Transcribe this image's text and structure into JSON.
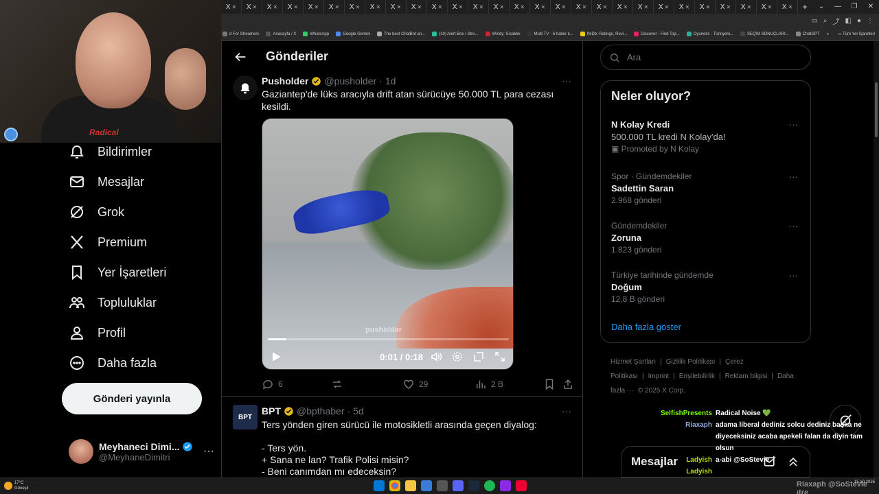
{
  "browser": {
    "tab_label": "X",
    "tab_count": 28,
    "bookmarks": [
      {
        "label": "d For Streamers",
        "color": "#777"
      },
      {
        "label": "Anasayfa / X",
        "color": "#555"
      },
      {
        "label": "WhatsApp",
        "color": "#25d366"
      },
      {
        "label": "Google Gemini",
        "color": "#4a8af4"
      },
      {
        "label": "The best ChatBot an...",
        "color": "#aaa"
      },
      {
        "label": "(19) Alert Box / Stre...",
        "color": "#2fbf9b"
      },
      {
        "label": "Windy: Sıcaklık",
        "color": "#c23"
      },
      {
        "label": "Multi TV - 6 haber k...",
        "color": "#333"
      },
      {
        "label": "IMDb: Ratings, Revi...",
        "color": "#f5c518"
      },
      {
        "label": "Discover - Find Top...",
        "color": "#e0245e"
      },
      {
        "label": "Oyuneks - Türkiyeni...",
        "color": "#3a9"
      },
      {
        "label": "SEÇİM SONUÇLARI...",
        "color": "#444"
      },
      {
        "label": "ChatGPT",
        "color": "#888"
      }
    ],
    "bookmarks_more": "»",
    "all_bookmarks": "Tüm Yer İşaretleri"
  },
  "webcam": {
    "shirt_text": "Radical"
  },
  "nav": {
    "items": [
      {
        "label": "Bildirimler",
        "icon": "bell-icon"
      },
      {
        "label": "Mesajlar",
        "icon": "mail-icon"
      },
      {
        "label": "Grok",
        "icon": "grok-icon"
      },
      {
        "label": "Premium",
        "icon": "x-logo-icon"
      },
      {
        "label": "Yer İşaretleri",
        "icon": "bookmark-icon"
      },
      {
        "label": "Topluluklar",
        "icon": "communities-icon"
      },
      {
        "label": "Profil",
        "icon": "profile-icon"
      },
      {
        "label": "Daha fazla",
        "icon": "more-circle-icon"
      }
    ],
    "post_button": "Gönderi yayınla",
    "profile": {
      "name": "Meyhaneci Dimi...",
      "handle": "@MeyhaneDimitri",
      "more": "···"
    }
  },
  "main": {
    "title": "Gönderiler",
    "tweets": [
      {
        "name": "Pusholder",
        "handle": "@pusholder",
        "sep": "·",
        "time": "1d",
        "text": "Gaziantep'de lüks aracıyla drift atan sürücüye 50.000 TL para cezası kesildi.",
        "video": {
          "watermark": "pusholder",
          "time": "0:01 / 0:18",
          "progress": 0.077
        },
        "replies": "6",
        "likes": "29",
        "views": "2 B"
      },
      {
        "name": "BPT",
        "handle": "@bpthaber",
        "sep": "·",
        "time": "5d",
        "avatar_text": "BPT",
        "lines": [
          "Ters yönden giren sürücü ile motosikletli arasında geçen diyalog:",
          "",
          "- Ters yön.",
          "+ Sana ne lan? Trafik Polisi misin?",
          "- Beni canımdan mı edeceksin?"
        ]
      }
    ]
  },
  "sidebar": {
    "search_placeholder": "Ara",
    "trends_title": "Neler oluyor?",
    "trends": [
      {
        "context": "",
        "name": "N Kolay Kredi",
        "desc": "500.000 TL kredi N Kolay'da!",
        "sub": "Promoted by N Kolay"
      },
      {
        "context": "Spor · Gündemdekiler",
        "name": "Sadettin Saran",
        "desc": "",
        "sub": "2.968 gönderi"
      },
      {
        "context": "Gündemdekiler",
        "name": "Zoruna",
        "desc": "",
        "sub": "1.823 gönderi"
      },
      {
        "context": "Türkiye tarihinde gündemde",
        "name": "Doğum",
        "desc": "",
        "sub": "12,8 B gönderi"
      }
    ],
    "show_more": "Daha fazla göster",
    "footer": [
      "Hizmet Şartları",
      "|",
      "Gizlilik Politikası",
      "|",
      "Çerez Politikası",
      "|",
      "Imprint",
      "|",
      "Erişilebilirlik",
      "|",
      "Reklam bilgisi",
      "|",
      "Daha fazla ···",
      "© 2025 X Corp."
    ]
  },
  "chat": [
    {
      "user": "SelfishPresents",
      "color": "#7cfc00",
      "msg": "Radical Noise 💚"
    },
    {
      "user": "Riaxaph",
      "color": "#8fa9d9",
      "msg": "adama liberal dediniz solcu dediniz başka ne diyeceksiniz acaba apekeli falan da diyin tam olsun"
    },
    {
      "user": "Ladyish",
      "color": "#b4e000",
      "msg": "a-abi @SoStevie"
    },
    {
      "user": "Ladyish",
      "color": "#b4e000",
      "msg": ""
    }
  ],
  "messages_drawer": {
    "title": "Mesajlar"
  },
  "taskbar": {
    "weather_temp": "17°C",
    "weather_desc": "Güneşli",
    "date": "15.10.2025",
    "overlay": "Riaxaph @SoStevie ıtre"
  }
}
